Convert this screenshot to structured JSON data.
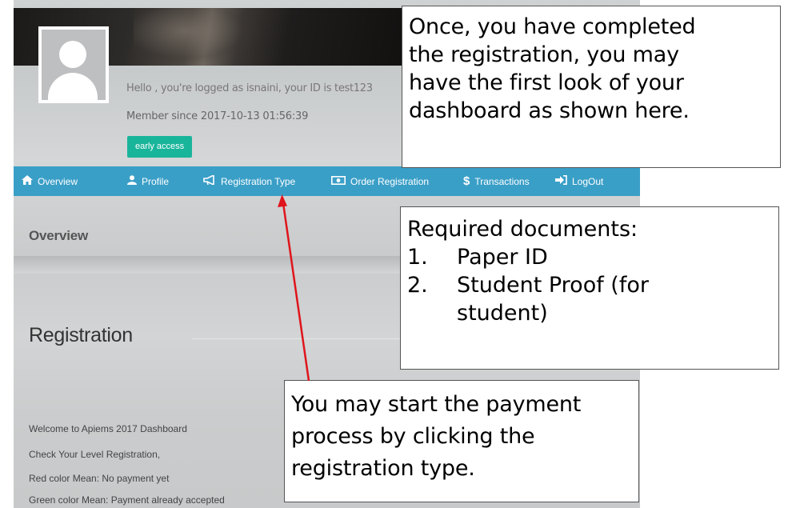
{
  "dashboard": {
    "greeting_prefix": "Hello , you're logged as ",
    "username": "isnaini",
    "greeting_mid": ", your ID is ",
    "user_id": "test123",
    "member_since": "Member since 2017-10-13 01:56:39",
    "badge": "early access"
  },
  "nav": {
    "items": [
      {
        "label": "Overview",
        "icon": "home-icon"
      },
      {
        "label": "Profile",
        "icon": "user-icon"
      },
      {
        "label": "Registration Type",
        "icon": "megaphone-icon"
      },
      {
        "label": "Order Registration",
        "icon": "money-icon"
      },
      {
        "label": "Transactions",
        "icon": "dollar-icon"
      },
      {
        "label": "LogOut",
        "icon": "logout-icon"
      }
    ]
  },
  "overview": {
    "title": "Overview"
  },
  "registration": {
    "title": "Registration",
    "lines": [
      "Welcome to Apiems 2017 Dashboard",
      "Check Your Level Registration,",
      "Red color Mean: No payment yet",
      "Green color Mean: Payment already accepted"
    ]
  },
  "callouts": {
    "completed": [
      "Once, you have completed",
      "the registration, you may",
      "have the first look of your",
      "dashboard as shown here."
    ],
    "documents": {
      "heading": "Required documents:",
      "items": [
        {
          "num": "1.",
          "text": "Paper ID"
        },
        {
          "num": "2.",
          "text": "Student Proof (for"
        },
        {
          "num": "",
          "text": "student)"
        }
      ]
    },
    "payment": [
      "You may start the payment",
      "process by clicking the",
      "registration type."
    ]
  },
  "colors": {
    "nav": "#3a9fc7",
    "badge": "#19b59b",
    "arrow": "#e0141b"
  }
}
